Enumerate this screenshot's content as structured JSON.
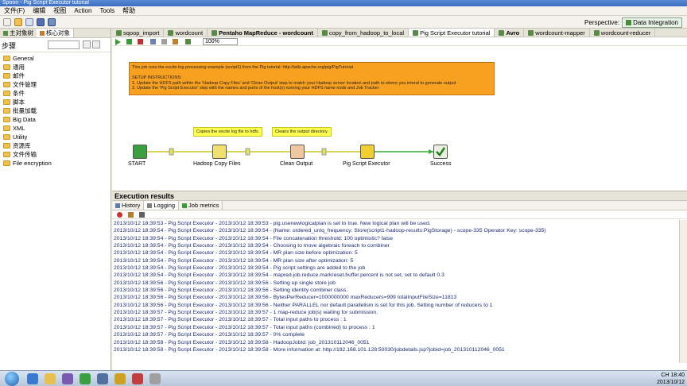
{
  "window": {
    "title": "Spoon - Pig Script Executor tutorial"
  },
  "menu": [
    "文件(F)",
    "编辑",
    "视图",
    "Action",
    "Tools",
    "帮助"
  ],
  "perspective": {
    "label": "Perspective:",
    "button": "Data Integration"
  },
  "left_panel": {
    "tabs": [
      "主对象树",
      "核心对象"
    ],
    "search_label": "步骤",
    "items": [
      "General",
      "通用",
      "邮件",
      "文件管理",
      "条件",
      "脚本",
      "批量加载",
      "Big Data",
      "XML",
      "Utility",
      "资源库",
      "文件传输",
      "File encryption"
    ]
  },
  "editor_tabs": [
    "sqoop_import",
    "wordcount",
    "Pentaho MapReduce - wordcount",
    "copy_from_hadoop_to_local",
    "Pig Script Executor tutorial",
    "Avro",
    "wordcount-mapper",
    "wordcount-reducer"
  ],
  "zoom": "100%",
  "setup_note": "This job runs the excite log processing example (script1) from the Pig tutorial: http://wiki.apache.org/pig/PigTutorial\n\nSETUP INSTRUCTIONS:\n1. Update the HDFS path within the 'Hadoop Copy Files' and 'Clean Output' step to match your Hadoop server location and path to where you intend to generate output\n2. Update the 'Pig Script Executor' step with the names and ports of the host(s) running your HDFS name node and Job Tracker",
  "notes": [
    "Copies the excite log file to hdfs.",
    "Cleans the output directory."
  ],
  "steps": [
    "START",
    "Hadoop Copy Files",
    "Clean Output",
    "Pig Script Executor",
    "Success"
  ],
  "results": {
    "title": "Execution results",
    "tabs": [
      "History",
      "Logging",
      "Job metrics"
    ],
    "log": [
      "2013/10/12 18:39:53 - Pig Script Executor - 2013/10/12 18:39:53 - pig.usenewlogicalplan is set to true. New logical plan will be used.",
      "2013/10/12 18:39:54 - Pig Script Executor - 2013/10/12 18:39:54 - (Name: ordered_uniq_frequency: Store(script1-hadoop-results:PigStorage) - scope-335 Operator Key: scope-335)",
      "2013/10/12 18:39:54 - Pig Script Executor - 2013/10/12 18:39:54 - File concatenation threshold: 100 optimistic? false",
      "2013/10/12 18:39:54 - Pig Script Executor - 2013/10/12 18:39:54 - Choosing to move algebraic foreach to combiner",
      "2013/10/12 18:39:54 - Pig Script Executor - 2013/10/12 18:39:54 - MR plan size before optimization: 5",
      "2013/10/12 18:39:54 - Pig Script Executor - 2013/10/12 18:39:54 - MR plan size after optimization: 5",
      "2013/10/12 18:39:54 - Pig Script Executor - 2013/10/12 18:39:54 - Pig script settings are added to the job",
      "2013/10/12 18:39:54 - Pig Script Executor - 2013/10/12 18:39:54 - mapred.job.reduce.markreset.buffer.percent is not set, set to default 0.3",
      "2013/10/12 18:39:56 - Pig Script Executor - 2013/10/12 18:39:56 - Setting up single store job",
      "2013/10/12 18:39:56 - Pig Script Executor - 2013/10/12 18:39:56 - Setting identity combiner class.",
      "2013/10/12 18:39:56 - Pig Script Executor - 2013/10/12 18:39:56 - BytesPerReducer=1000000000 maxReducers=999 totalInputFileSize=11813",
      "2013/10/12 18:39:56 - Pig Script Executor - 2013/10/12 18:39:56 - Neither PARALLEL nor default parallelism is set for this job. Setting number of reducers to 1",
      "2013/10/12 18:39:57 - Pig Script Executor - 2013/10/12 18:39:57 - 1 map-reduce job(s) waiting for submission.",
      "2013/10/12 18:39:57 - Pig Script Executor - 2013/10/12 18:39:57 - Total input paths to process : 1",
      "2013/10/12 18:39:57 - Pig Script Executor - 2013/10/12 18:39:57 - Total input paths (combined) to process : 1",
      "2013/10/12 18:39:57 - Pig Script Executor - 2013/10/12 18:39:57 - 0% complete",
      "2013/10/12 18:39:58 - Pig Script Executor - 2013/10/12 18:39:58 - HadoopJobId: job_201310112046_0051",
      "2013/10/12 18:39:58 - Pig Script Executor - 2013/10/12 18:39:58 - More information at: http://192.168.101.128:50030/jobdetails.jsp?jobid=job_201310112046_0051"
    ]
  },
  "taskbar": {
    "time": "18:40",
    "date": "2013/10/12",
    "lang": "CH"
  }
}
